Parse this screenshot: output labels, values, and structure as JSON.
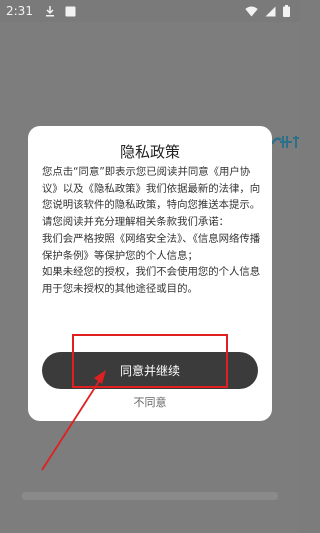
{
  "status_bar": {
    "time": "2:31",
    "icons": [
      "download-icon",
      "blank-square-icon",
      "wifi-icon",
      "signal-icon",
      "battery-icon"
    ]
  },
  "background": {
    "logo_icon": "app-logo-icon"
  },
  "dialog": {
    "title": "隐私政策",
    "paragraphs": [
      "您点击“同意”即表示您已阅读并同意《用户协议》以及《隐私政策》我们依据最新的法律，向您说明该软件的隐私政策，特向您推送本提示。请您阅读并充分理解相关条款我们承诺：",
      "我们会严格按照《网络安全法》、《信息网络传播保护条例》等保护您的个人信息；",
      "如果未经您的授权，我们不会使用您的个人信息用于您未授权的其他途径或目的。"
    ],
    "agree_label": "同意并继续",
    "disagree_label": "不同意"
  },
  "annotation": {
    "color": "#e02020"
  },
  "colors": {
    "overlay": "#7c7c7c",
    "dialog_bg": "#ffffff",
    "button_bg": "#3b3b3b",
    "button_text": "#ffffff"
  }
}
